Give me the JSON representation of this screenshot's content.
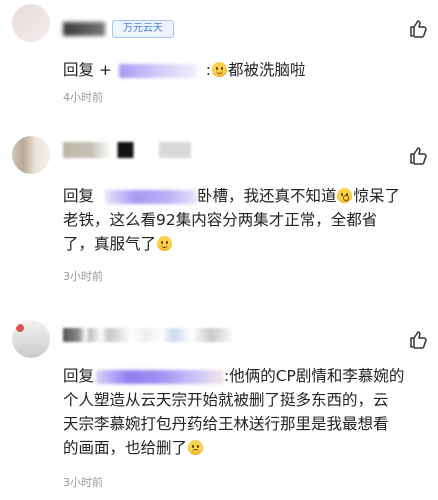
{
  "comments": [
    {
      "header_text": "万元云天",
      "reply_prefix": "回复 +",
      "reply_text": ":",
      "reply_tail": "都被洗脑啦",
      "time": "4小时前"
    },
    {
      "reply_prefix": "回复",
      "reply_body_1": "卧槽，我还真不知道",
      "reply_body_2": "惊呆了",
      "reply_body_3": "老铁，这么看92集内容分两集才正常，全都省",
      "reply_body_4": "了，真服气了",
      "time": "3小时前"
    },
    {
      "reply_prefix": "回复",
      "reply_body_1": ":他俩的CP剧情和李慕婉的",
      "reply_body_2": "个人塑造从云天宗开始就被删了挺多东西的，云",
      "reply_body_3": "天宗李慕婉打包丹药给王林送行那里是我最想看",
      "reply_body_4": "的画面，也给删了",
      "time": "3小时前"
    }
  ],
  "icons": {
    "like": "thumbs-up-icon"
  },
  "colors": {
    "time": "#9a9a9a",
    "text": "#222222",
    "blur_purple": "#9b8cf2"
  }
}
